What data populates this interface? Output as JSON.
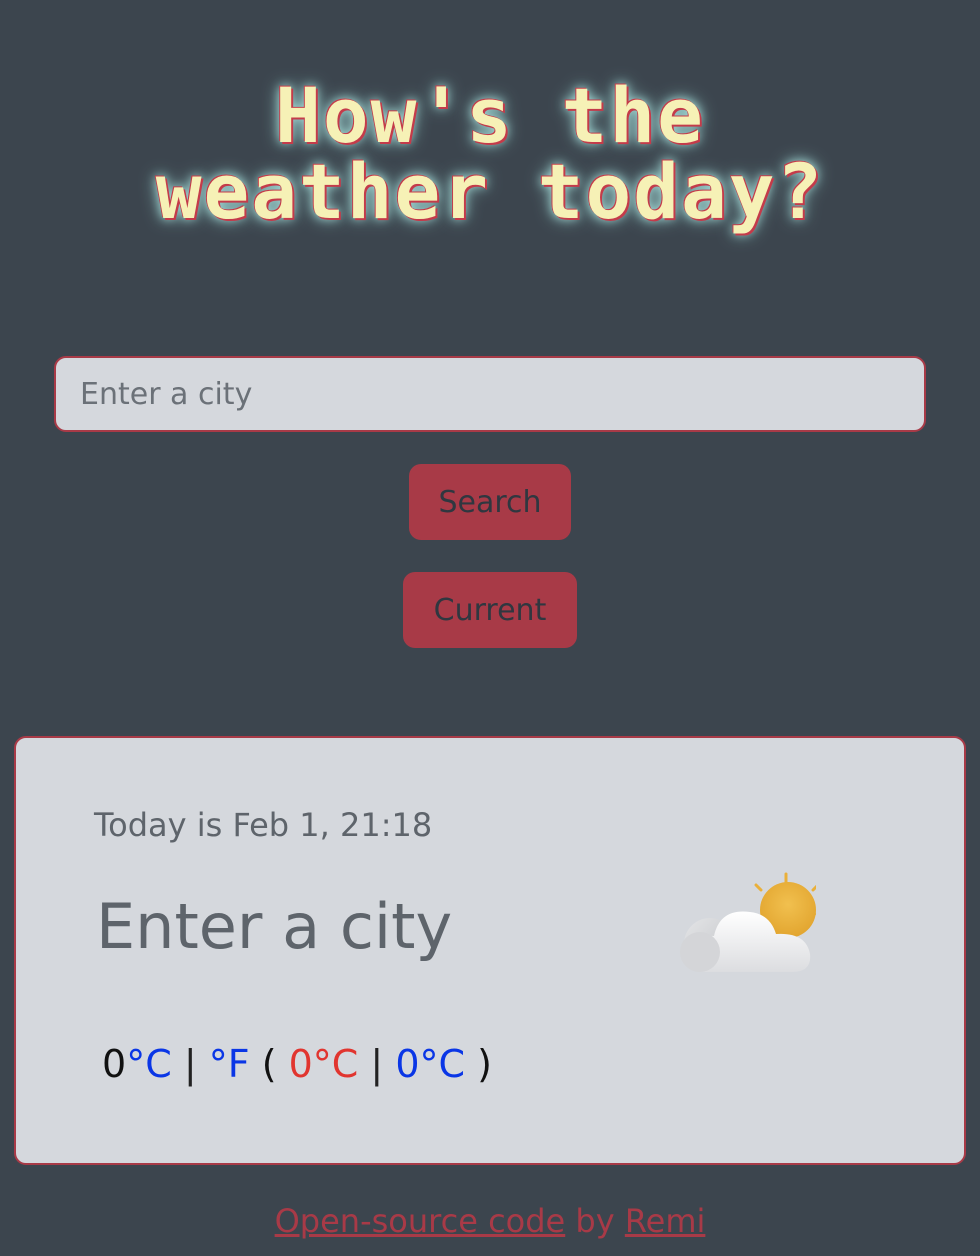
{
  "header": {
    "title_line1": "How's the",
    "title_line2": "weather today?"
  },
  "search": {
    "placeholder": "Enter a city",
    "search_label": "Search",
    "current_label": "Current"
  },
  "card": {
    "date_text": "Today is Feb 1, 21:18",
    "city": "Enter a city",
    "icon": "partly-cloudy-icon",
    "temperature": "0",
    "unit_celsius": "°C",
    "unit_fahrenheit": "°F",
    "separator": "|",
    "paren_open": "(",
    "paren_close": ")",
    "max_temp": "0°C",
    "min_temp": "0°C"
  },
  "footer": {
    "code_link": "Open-source code",
    "by_text": "by",
    "author_link": "Remi"
  },
  "colors": {
    "background": "#3c454e",
    "accent": "#a83a47",
    "card": "#d5d8dd",
    "title": "#f6f1b6",
    "unit_blue": "#0a36e6",
    "max_red": "#e1352f"
  }
}
